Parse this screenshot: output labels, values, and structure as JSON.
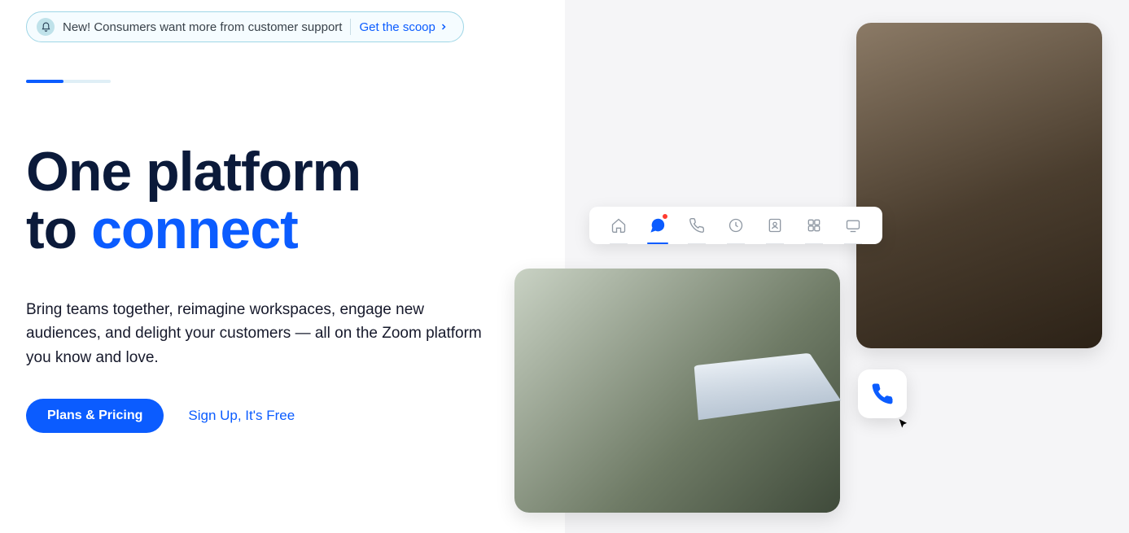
{
  "announcement": {
    "text": "New! Consumers want more from customer support",
    "cta": "Get the scoop"
  },
  "hero": {
    "line1": "One platform",
    "line2_prefix": "to ",
    "line2_accent": "connect",
    "subtitle": "Bring teams together, reimagine workspaces, engage new audiences, and delight your customers — all on the Zoom platform you know and love."
  },
  "cta": {
    "primary": "Plans & Pricing",
    "secondary": "Sign Up, It's Free"
  },
  "toolbar_icons": [
    {
      "name": "home-icon",
      "active": false,
      "badge": false
    },
    {
      "name": "chat-icon",
      "active": true,
      "badge": true
    },
    {
      "name": "phone-icon",
      "active": false,
      "badge": false
    },
    {
      "name": "clock-icon",
      "active": false,
      "badge": false
    },
    {
      "name": "contacts-icon",
      "active": false,
      "badge": false
    },
    {
      "name": "apps-icon",
      "active": false,
      "badge": false
    },
    {
      "name": "screen-icon",
      "active": false,
      "badge": false
    }
  ],
  "colors": {
    "accent": "#0b5cff",
    "text": "#0b1a3a",
    "panel": "#f5f5f7"
  }
}
